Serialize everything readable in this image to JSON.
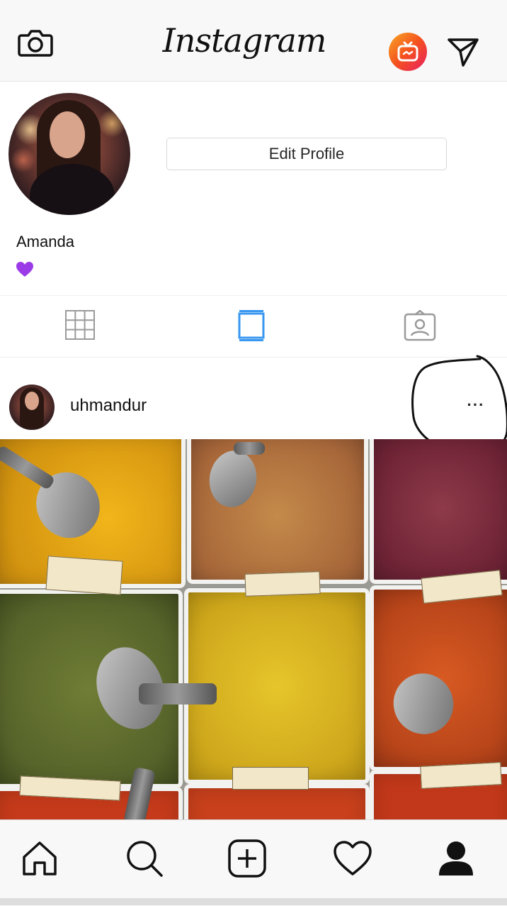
{
  "app": {
    "logo_text": "Instagram",
    "accent_color": "#3897f0",
    "igtv_gradient": [
      "#f9a825",
      "#f4511e",
      "#e91e63"
    ]
  },
  "header": {
    "camera_icon": "camera-icon",
    "igtv_icon": "igtv-icon",
    "direct_icon": "paper-plane-icon"
  },
  "profile": {
    "edit_button_label": "Edit Profile",
    "display_name": "Amanda",
    "bio_emoji": "purple-heart-icon"
  },
  "tabs": [
    {
      "name": "grid-icon",
      "selected": false
    },
    {
      "name": "feed-list-icon",
      "selected": true
    },
    {
      "name": "tagged-icon",
      "selected": false
    }
  ],
  "post": {
    "username": "uhmandur",
    "more_label": "···",
    "image_description_icon": "spices-photo"
  },
  "bottom_nav": [
    {
      "name": "home-icon"
    },
    {
      "name": "search-icon"
    },
    {
      "name": "new-post-icon"
    },
    {
      "name": "activity-heart-icon"
    },
    {
      "name": "profile-icon",
      "selected": true
    }
  ]
}
